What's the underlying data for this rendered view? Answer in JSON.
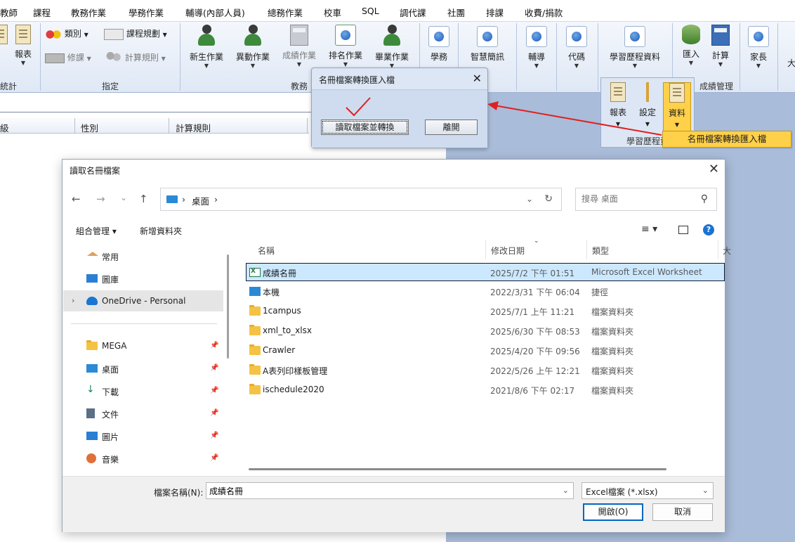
{
  "menubar": {
    "items": [
      "教師",
      "課程",
      "教務作業",
      "學務作業",
      "輔導(內部人員)",
      "總務作業",
      "校車",
      "SQL",
      "調代課",
      "社團",
      "排課",
      "收費/捐款"
    ]
  },
  "ribbon": {
    "group1": {
      "report_label": "報表",
      "title": "統計"
    },
    "group2": {
      "category": "類別",
      "course_plan": "課程規劃",
      "repair": "修課",
      "calc_rule": "計算規則",
      "title": "指定"
    },
    "group3": {
      "new_student": "新生作業",
      "transfer": "異動作業",
      "score": "成績作業",
      "rank": "排名作業",
      "graduation": "畢業作業",
      "title": "教務"
    },
    "single_buttons": [
      "學務",
      "智慧簡訊",
      "輔導",
      "代碼"
    ],
    "history": {
      "label": "學習歷程資料"
    },
    "import": "匯入",
    "compute": "計算",
    "score_mgmt_title": "成績管理",
    "parent": "家長",
    "truncated": "大"
  },
  "popup": {
    "report": "報表",
    "setting": "設定",
    "data": "資料",
    "title": "學習歷程資",
    "menu_item": "名冊檔案轉換匯入檔"
  },
  "grid": {
    "columns": [
      "級",
      "性別",
      "計算規則"
    ]
  },
  "small_dialog": {
    "title": "名冊檔案轉換匯入檔",
    "read_button": "讀取檔案並轉換",
    "leave_button": "離開",
    "close": "✕",
    "checkmark_color": "#e02020"
  },
  "annotation": {
    "arrow_color": "#e02020"
  },
  "file_dialog": {
    "title": "讀取名冊檔案",
    "close": "✕",
    "nav": {
      "back": "←",
      "forward": "→",
      "recent": "⌄",
      "up": "↑"
    },
    "address": {
      "crumb": "桌面",
      "sep": "›"
    },
    "search_placeholder": "搜尋 桌面",
    "toolbar": {
      "organize": "組合管理 ▾",
      "new_folder": "新增資料夾"
    },
    "nav_pane": [
      {
        "label": "常用",
        "icon": "home-icon",
        "pinned": false
      },
      {
        "label": "圖庫",
        "icon": "gallery-icon",
        "pinned": false
      },
      {
        "label": "OneDrive - Personal",
        "icon": "cloud-icon",
        "pinned": false,
        "selected": true
      },
      {
        "label": "MEGA",
        "icon": "folder-icon",
        "pinned": true
      },
      {
        "label": "桌面",
        "icon": "desktop-icon",
        "pinned": true
      },
      {
        "label": "下載",
        "icon": "download-icon",
        "pinned": true
      },
      {
        "label": "文件",
        "icon": "document-icon",
        "pinned": true
      },
      {
        "label": "圖片",
        "icon": "picture-icon",
        "pinned": true
      },
      {
        "label": "音樂",
        "icon": "music-icon",
        "pinned": true
      }
    ],
    "columns": {
      "name": "名稱",
      "modified": "修改日期",
      "type": "類型",
      "extra": "大"
    },
    "files": [
      {
        "name": "成績名冊",
        "date": "2025/7/2 下午 01:51",
        "type": "Microsoft Excel Worksheet",
        "icon": "excel-file-icon",
        "selected": true
      },
      {
        "name": "本機",
        "date": "2022/3/31 下午 06:04",
        "type": "捷徑",
        "icon": "shortcut-icon"
      },
      {
        "name": "1campus",
        "date": "2025/7/1 上午 11:21",
        "type": "檔案資料夾",
        "icon": "folder-icon"
      },
      {
        "name": "xml_to_xlsx",
        "date": "2025/6/30 下午 08:53",
        "type": "檔案資料夾",
        "icon": "folder-icon"
      },
      {
        "name": "Crawler",
        "date": "2025/4/20 下午 09:56",
        "type": "檔案資料夾",
        "icon": "folder-icon"
      },
      {
        "name": "A表列印樣板管理",
        "date": "2022/5/26 上午 12:21",
        "type": "檔案資料夾",
        "icon": "folder-icon"
      },
      {
        "name": "ischedule2020",
        "date": "2021/8/6 下午 02:17",
        "type": "檔案資料夾",
        "icon": "folder-icon"
      }
    ],
    "filename_label": "檔案名稱(N):",
    "filename_value": "成績名冊",
    "filetype_value": "Excel檔案 (*.xlsx)",
    "open_button": "開啟(O)",
    "cancel_button": "取消"
  }
}
